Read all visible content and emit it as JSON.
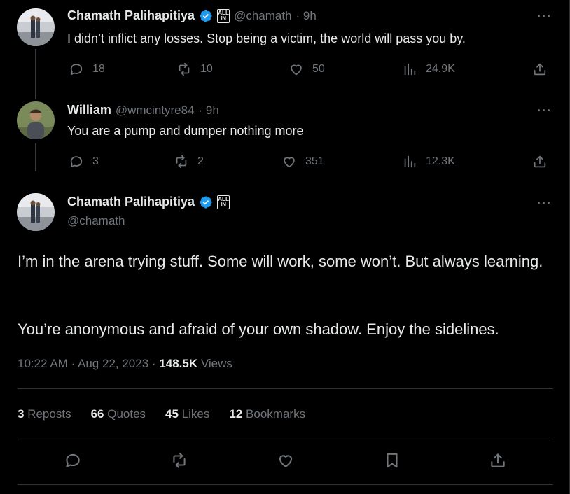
{
  "colors": {
    "background": "#000000",
    "text": "#e7e9ea",
    "muted": "#71767b",
    "verified": "#1d9bf0"
  },
  "tweet1": {
    "name": "Chamath Palihapitiya",
    "badge_top": "ALL",
    "badge_bottom": "IN",
    "handle": "@chamath",
    "time": "· 9h",
    "text": "I didn’t inflict any losses. Stop being a victim, the world will pass you by.",
    "more": "···",
    "replies": "18",
    "reposts": "10",
    "likes": "50",
    "views": "24.9K"
  },
  "tweet2": {
    "name": "William",
    "handle": "@wmcintyre84",
    "time": "· 9h",
    "text": "You are a pump and dumper nothing more",
    "more": "···",
    "replies": "3",
    "reposts": "2",
    "likes": "351",
    "views": "12.3K"
  },
  "main": {
    "name": "Chamath Palihapitiya",
    "badge_top": "ALL",
    "badge_bottom": "IN",
    "handle": "@chamath",
    "more": "···",
    "paragraph1": "I’m in the arena trying stuff. Some will work, some won’t. But always learning.",
    "paragraph2": "You’re anonymous and afraid of your own shadow. Enjoy the sidelines.",
    "time": "10:22 AM",
    "date": "Aug 22, 2023",
    "views_count": "148.5K",
    "views_label": "Views",
    "stats": {
      "reposts_count": "3",
      "reposts_label": "Reposts",
      "quotes_count": "66",
      "quotes_label": "Quotes",
      "likes_count": "45",
      "likes_label": "Likes",
      "bookmarks_count": "12",
      "bookmarks_label": "Bookmarks"
    }
  },
  "icons": [
    "reply-icon",
    "repost-icon",
    "like-icon",
    "views-icon",
    "share-icon",
    "bookmark-icon",
    "verified-icon",
    "more-icon"
  ]
}
